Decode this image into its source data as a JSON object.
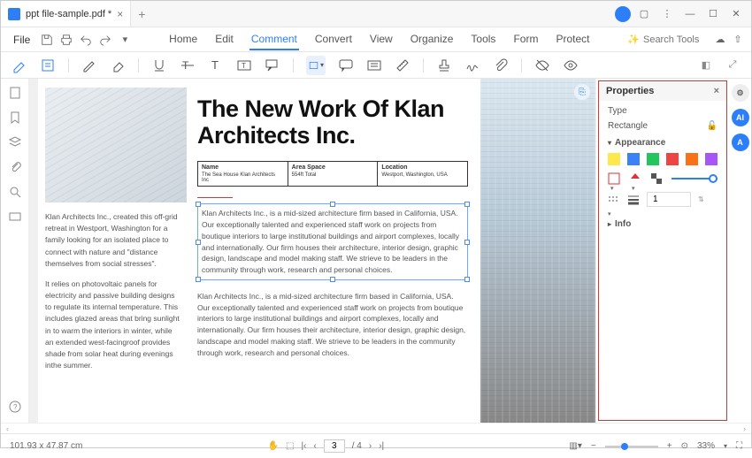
{
  "titlebar": {
    "tab_title": "ppt file-sample.pdf *"
  },
  "menubar": {
    "file": "File",
    "items": [
      "Home",
      "Edit",
      "Comment",
      "Convert",
      "View",
      "Organize",
      "Tools",
      "Form",
      "Protect"
    ],
    "active_index": 2,
    "search_placeholder": "Search Tools"
  },
  "properties": {
    "title": "Properties",
    "type_label": "Type",
    "type_value": "Rectangle",
    "appearance_label": "Appearance",
    "swatches": [
      "#ffe84a",
      "#3b82f6",
      "#22c55e",
      "#ef4444",
      "#f97316",
      "#a855f7"
    ],
    "thickness_value": "1",
    "info_label": "Info"
  },
  "document": {
    "heading": "The New Work Of Klan Architects Inc.",
    "table": {
      "name_h": "Name",
      "name_v": "The Sea House Klan Architects Inc",
      "area_h": "Area Space",
      "area_v": "554ft Total",
      "loc_h": "Location",
      "loc_v": "Westport, Washington, USA"
    },
    "left_p1": "Klan Architects Inc., created this off-grid retreat in Westport, Washington for a family looking for an isolated place to connect with nature and \"distance themselves from social stresses\".",
    "left_p2": "It relies on photovoltaic panels for electricity and passive building designs to regulate its internal temperature. This includes glazed areas that bring sunlight in to warm the interiors in winter, while an extended west-facingroof provides shade from solar heat during evenings inthe summer.",
    "mid_p": "Klan Architects Inc., is a mid-sized architecture firm based in California, USA. Our exceptionally talented and experienced staff work on projects from boutique interiors to large institutional buildings and airport complexes, locally and internationally. Our firm houses their architecture, interior design, graphic design, landscape and model making staff. We strieve to be leaders in the community through work, research and personal choices."
  },
  "statusbar": {
    "coords": "101.93 x 47.87 cm",
    "page_current": "3",
    "page_total": "/ 4",
    "zoom": "33%"
  }
}
